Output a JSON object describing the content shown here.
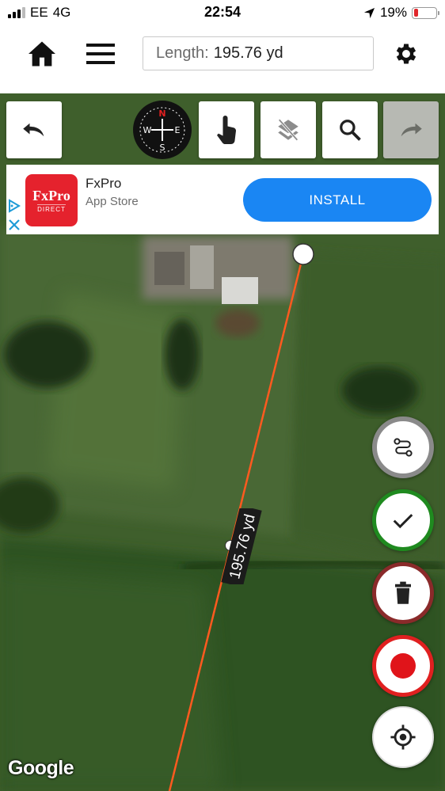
{
  "status_bar": {
    "carrier": "EE",
    "network": "4G",
    "time": "22:54",
    "battery": "19%",
    "battery_level": 0.19
  },
  "toolbar": {
    "length_label": "Length:",
    "length_value": "195.76 yd",
    "icons": [
      "home-icon",
      "menu-icon",
      "settings-icon"
    ]
  },
  "map_tools": {
    "compass": {
      "n": "N",
      "s": "S",
      "e": "E",
      "w": "W"
    },
    "buttons": [
      "undo-icon",
      "touch-icon",
      "layers-icon",
      "search-icon",
      "redo-icon"
    ]
  },
  "ad": {
    "logo_brand": "FxPro",
    "logo_sub": "DIRECT",
    "title": "FxPro",
    "store": "App Store",
    "install_label": "INSTALL"
  },
  "measurement": {
    "label": "195.76 yd"
  },
  "fabs": [
    "route-icon",
    "check-icon",
    "trash-icon",
    "record-icon",
    "locate-icon"
  ],
  "map_attribution": "Google",
  "colors": {
    "line": "#ff5a1f",
    "install": "#1a86f3",
    "ad_logo": "#e5222d",
    "ok": "#1f8a1f",
    "delete": "#8a2a2a",
    "record": "#e02020"
  }
}
